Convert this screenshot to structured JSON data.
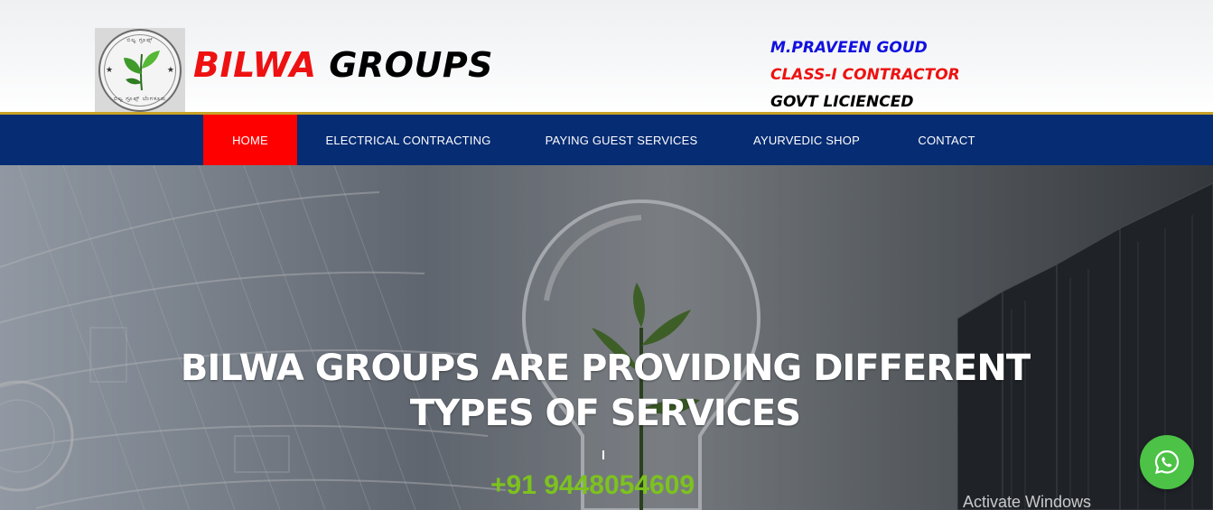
{
  "header": {
    "logo": {
      "name": "bilwa-groups-logo",
      "arc_top": "ಬಿಲ್ವ ಗ್ರೂಪ್ಸ್",
      "arc_bottom": "ಬಿಲ್ವ ಗ್ರೂಪ್ಸ್ ಬೆಂಗಳೂರು"
    },
    "brand_part1": "BILWA",
    "brand_part2": "GROUPS",
    "contractor": {
      "name": "M.PRAVEEN GOUD",
      "class": "CLASS-I CONTRACTOR",
      "license": "GOVT LICIENCED"
    }
  },
  "nav": {
    "items": [
      {
        "label": "HOME",
        "active": true
      },
      {
        "label": "ELECTRICAL CONTRACTING",
        "active": false
      },
      {
        "label": "PAYING GUEST SERVICES",
        "active": false
      },
      {
        "label": "AYURVEDIC SHOP",
        "active": false
      },
      {
        "label": "CONTACT",
        "active": false
      }
    ]
  },
  "hero": {
    "title": "BILWA GROUPS ARE PROVIDING DIFFERENT TYPES OF SERVICES",
    "phone": "+91 9448054609"
  },
  "overlay": {
    "activate_windows": "Activate Windows"
  },
  "colors": {
    "nav_bg": "#062c73",
    "active_tab": "#ff0000",
    "gold_line": "#c9a227",
    "brand_red": "#ee1111",
    "phone_green": "#7dc21e",
    "whatsapp_green": "#4cc247"
  },
  "icons": {
    "whatsapp": "whatsapp-icon",
    "logo_leaf": "leaf-icon"
  }
}
